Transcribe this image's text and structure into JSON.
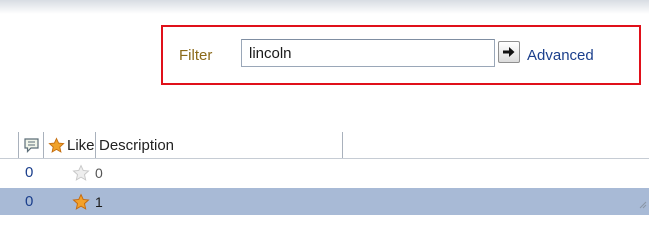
{
  "filter": {
    "label": "Filter",
    "value": "lincoln",
    "advanced_label": "Advanced",
    "highlight_color": "#e0101a"
  },
  "grid": {
    "columns": {
      "comments_icon": "comment-icon",
      "like_icon": "star-icon",
      "like_label": "Like",
      "description_label": "Description"
    },
    "rows": [
      {
        "comments": "0",
        "likes": "0",
        "liked": false,
        "selected": false
      },
      {
        "comments": "0",
        "likes": "1",
        "liked": true,
        "selected": true
      }
    ],
    "selected_row_color": "#a8bad6"
  }
}
